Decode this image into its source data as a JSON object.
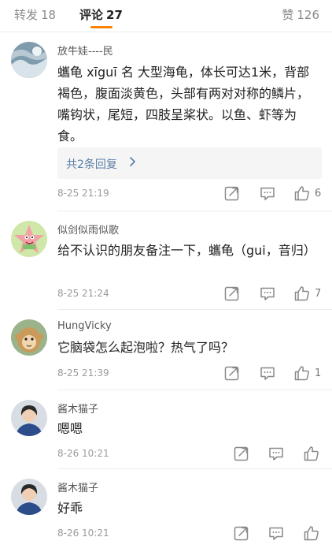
{
  "tabs": {
    "repost_label": "转发",
    "repost_count": "18",
    "comments_label": "评论",
    "comments_count": "27",
    "likes_label": "赞",
    "likes_count": "126"
  },
  "colors": {
    "accent": "#ff8200",
    "link": "#5a7fa8",
    "icon": "#888888"
  },
  "comments": [
    {
      "username": "放牛娃----民",
      "avatar_icon": "cloud-landscape-avatar",
      "content": "蠵龟 xīguī 名 大型海龟，体长可达1米，背部褐色，腹面淡黄色，头部有两对对称的鳞片，嘴钩状，尾短，四肢呈桨状。以鱼、虾等为食。",
      "replies_label": "共2条回复",
      "timestamp": "8-25 21:19",
      "likes": "6"
    },
    {
      "username": "似剑似雨似歌",
      "avatar_icon": "cartoon-starfish-avatar",
      "content": "给不认识的朋友备注一下，蠵龟（gui，音归）",
      "timestamp": "8-25 21:24",
      "likes": "7"
    },
    {
      "username": "HungVicky",
      "avatar_icon": "monkey-avatar",
      "content": "它脑袋怎么起泡啦？热气了吗？",
      "timestamp": "8-25 21:39",
      "likes": "1"
    },
    {
      "username": "酱木猫子",
      "avatar_icon": "person-avatar",
      "content": "嗯嗯",
      "timestamp": "8-26 10:21",
      "likes": ""
    },
    {
      "username": "酱木猫子",
      "avatar_icon": "person-avatar",
      "content": "好乖",
      "timestamp": "8-26 10:21",
      "likes": ""
    }
  ]
}
